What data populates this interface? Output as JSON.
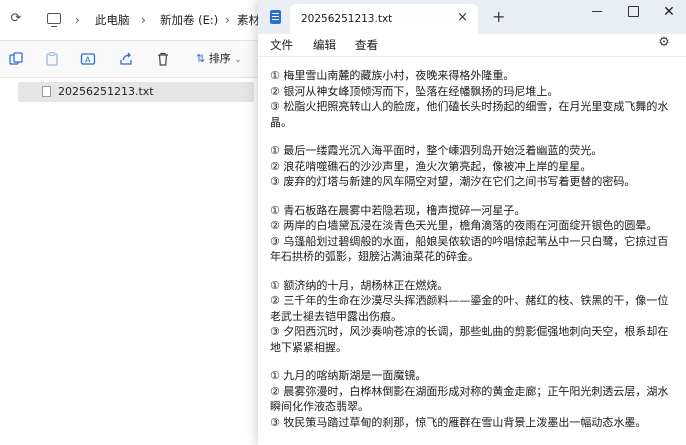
{
  "explorer": {
    "breadcrumbs": [
      "此电脑",
      "新加卷 (E:)",
      "素材"
    ],
    "toolbar": {
      "sort_label": "排序"
    },
    "file_list": [
      {
        "name": "20256251213.txt"
      }
    ]
  },
  "notepad": {
    "tab_title": "20256251213.txt",
    "tab_close": "×",
    "new_tab": "+",
    "close_glyph": "✕",
    "menu": [
      "文件",
      "编辑",
      "查看"
    ],
    "paragraphs": [
      [
        "① 梅里雪山南麓的藏族小村，夜晚来得格外隆重。",
        "② 银河从神女峰顶倾泻而下，坠落在经幡飘扬的玛尼堆上。",
        "③ 松脂火把照亮转山人的脸庞，他们磕长头时扬起的细雪，在月光里变成飞舞的水晶。"
      ],
      [
        "① 最后一缕霞光沉入海平面时，整个嵊泗列岛开始泛着幽蓝的荧光。",
        "② 浪花啃噬礁石的沙沙声里，渔火次第亮起，像被冲上岸的星星。",
        "③ 废弃的灯塔与新建的风车隔空对望，潮汐在它们之间书写着更替的密码。"
      ],
      [
        "① 青石板路在晨雾中若隐若现，橹声搅碎一河星子。",
        "② 两岸的白墙黛瓦浸在淡青色天光里，檐角滴落的夜雨在河面绽开银色的圆晕。",
        "③ 乌篷船划过碧绸般的水面，船娘吴侬软语的吟唱惊起苇丛中一只白鹭，它掠过百年石拱桥的弧影，翅膀沾满油菜花的碎金。"
      ],
      [
        "① 额济纳的十月，胡杨林正在燃烧。",
        "② 三千年的生命在沙漠尽头挥洒颜料——鎏金的叶、赭红的枝、铁黑的干，像一位老武士褪去铠甲露出伤痕。",
        "③ 夕阳西沉时，风沙奏响苍凉的长调，那些虬曲的剪影倔强地刺向天空，根系却在地下紧紧相握。"
      ],
      [
        "① 九月的喀纳斯湖是一面魔镜。",
        "② 晨雾弥漫时，白桦林倒影在湖面形成对称的黄金走廊；正午阳光刺透云层，湖水瞬间化作液态翡翠。",
        "③ 牧民策马踏过草甸的刹那，惊飞的雁群在雪山背景上泼墨出一幅动态水墨。"
      ]
    ]
  }
}
